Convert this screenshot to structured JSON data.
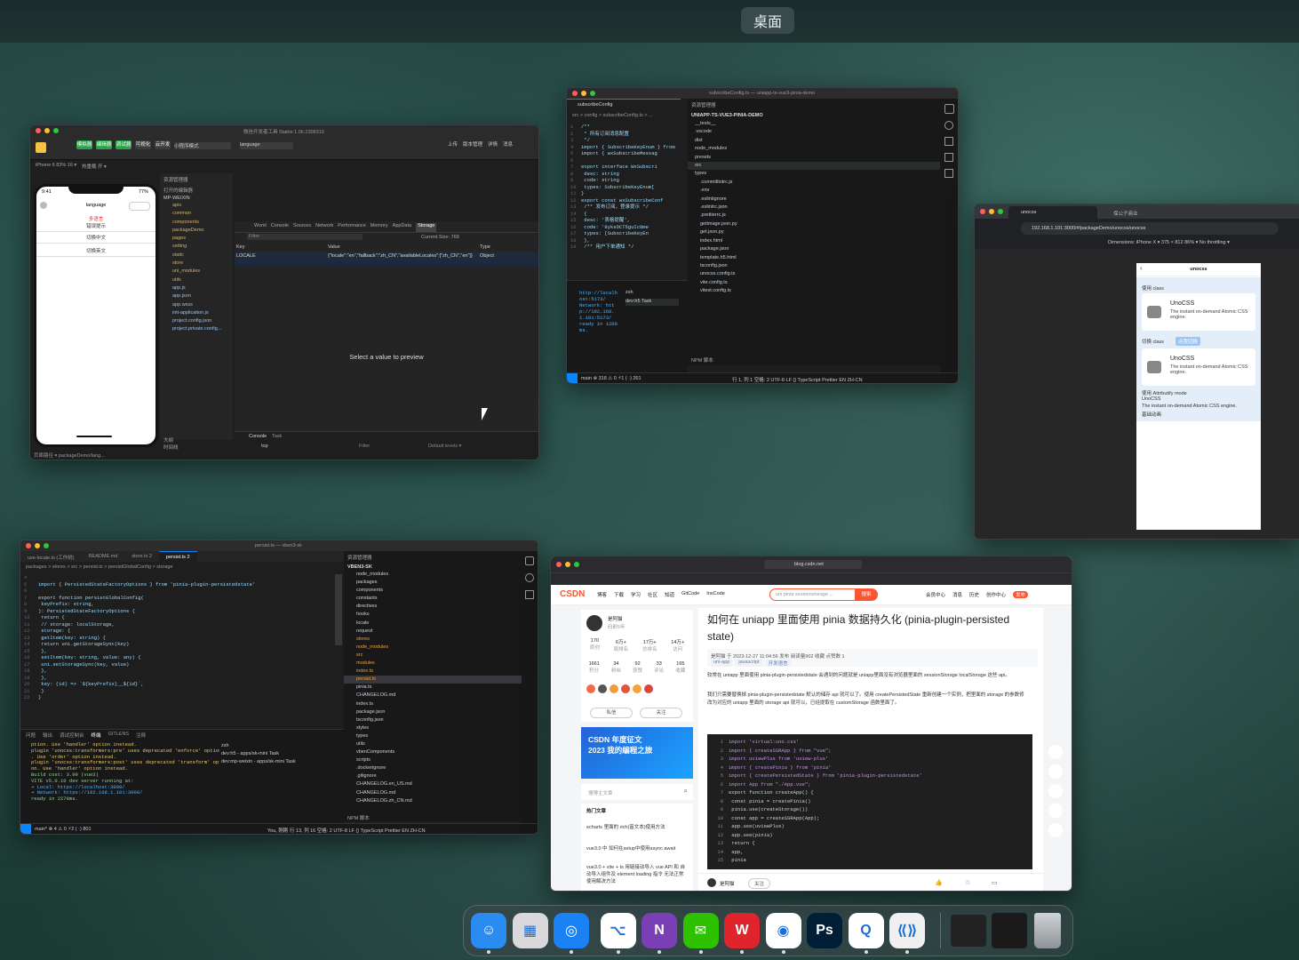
{
  "desktop": {
    "label": "桌面"
  },
  "devtools": {
    "title": "微信开发者工具 Stable 1.06.2308310",
    "toolbar": [
      "模拟器",
      "编辑器",
      "调试器",
      "可视化",
      "云开发",
      "上传",
      "版本管理",
      "详情",
      "消息"
    ],
    "compile_mode": "小程序模式",
    "device": "iPhone 6 83% 16 ▾",
    "hot_reload": "热重载 开 ▾",
    "phone": {
      "status_time": "9:41",
      "battery": "77%",
      "title": "language",
      "lines": [
        "多语言",
        "错误提示",
        "切换中文",
        "切换英文"
      ]
    },
    "explorer_title": "资源管理器",
    "open_editors": "打开的编辑器",
    "project_root": "MP-WEIXIN",
    "files": [
      "apis",
      "common",
      "components",
      "packageDemo",
      "pages",
      "setting",
      "static",
      "store",
      "uni_modules",
      "utils",
      "app.js",
      "app.json",
      "app.wxss",
      "init-application.js",
      "project.config.json",
      "project.private.config..."
    ],
    "debug_tabs": [
      "Wxml",
      "Console",
      "Sources",
      "Network",
      "Performance",
      "Memory",
      "AppData",
      "Storage"
    ],
    "filter_placeholder": "Filter",
    "storage_size": "Current Size: 768",
    "storage_headers": [
      "Key",
      "Value",
      "Type"
    ],
    "storage_row": {
      "key": "LOCALE",
      "value": "{\"locale\":\"en\",\"fallback\":\"zh_CN\",\"availableLocales\":[\"zh_CN\",\"en\"]}",
      "type": "Object"
    },
    "preview_placeholder": "Select a value to preview",
    "console_tabs": [
      "Console",
      "Task"
    ],
    "console_context": "top",
    "console_filter": "Filter",
    "console_levels": "Default levels ▾",
    "outline": [
      "大纲",
      "时间线"
    ],
    "statusbar": "页面路径 ▾  packageDemo/lang..."
  },
  "vscode1": {
    "title": "subscribeConfig.ts — uniapp-ts-vue3-pinia-demo",
    "tab": "subscribeConfig",
    "breadcrumb": "src > config > subscribeConfig.ts > ...",
    "code": [
      "/**",
      " * 所有订阅消息配置",
      " */",
      "import { SubscribeKeyEnum } from",
      "import { wxSubscribeMessag",
      "",
      "export interface WxSubscri",
      "  desc: string",
      "  code: string",
      "  types: SubscribeKeyEnum[",
      "}",
      "export const wxSubscribeConf",
      "  /** 发布订阅，登录提示 */",
      "  {",
      "    desc: '表格提醒',",
      "    code: '8yksDCT5guIc8me",
      "    types: [SubscribeKeyEn",
      "  },",
      "  /** 用户下单通知 */"
    ],
    "explorer_title": "资源管理器",
    "project": "UNIAPP-TS-VUE3-PINIA-DEMO",
    "files": [
      "__tests__",
      ".vscode",
      "dist",
      "node_modules",
      "presets",
      "src",
      "types",
      ".commitlintrc.js",
      ".env",
      ".eslintignore",
      ".eslintrc.json",
      ".prettierrc.js",
      "getimage.json.py",
      "get.json.py",
      "index.html",
      "package.json",
      "template.h5.html",
      "tsconfig.json",
      "unocss.config.ts",
      "vite.config.ts",
      "vitest.config.ts"
    ],
    "terminal": [
      "http://localhost:5173/",
      "Network: http://192.168.1.101:5173/",
      "ready in 1209ms."
    ],
    "terminal_tabs": [
      "zsh",
      "dev:h5 Task"
    ],
    "npm": "NPM 脚本",
    "status_left": "main  ⊗ 318 ⚠ 0  ⚡1  ( ·) 261",
    "status_right": "行 1, 列 1  空格: 2  UTF-8  LF  {} TypeScript  Prettier  EN  ZH-CN"
  },
  "browser": {
    "tabs": [
      "unocss",
      "保公子商业"
    ],
    "url": "192.168.1.101:3000/#/packageDemo/unocss/unocss",
    "device_bar": "Dimensions: iPhone X ▾   375  ×  812   86% ▾  No throttling ▾",
    "page_title": "unocss",
    "section1": "使用 class",
    "card_title": "UnoCSS",
    "card_desc": "The instant on-demand Atomic CSS engine.",
    "section2": "切换 class",
    "badge": "点我切换",
    "section3": "使用 Attributify mode",
    "attr_title": "UnoCSS",
    "attr_desc": "The instant on-demand Atomic CSS engine.",
    "attr_extra": "基础动画"
  },
  "vscode2": {
    "title": "persist.ts — vben3-sk",
    "tabs": [
      "use-locale.ts (工作树)",
      "README.md",
      "store.ts 2",
      "persist.ts 2"
    ],
    "breadcrumb": "packages > stores > src > persist.ts > persistGlobalConfig > storage",
    "code": [
      "",
      "import { PersistedStateFactoryOptions } from 'pinia-plugin-persistedstate'",
      "",
      "export function persistGlobalConfig(",
      "  keyPrefix: string,",
      "): PersistedStateFactoryOptions {",
      "  return {",
      "    // storage: localStorage,",
      "    storage: {",
      "      getItem(key: string) {",
      "        return uni.getStorageSync(key)",
      "      },",
      "      setItem(key: string, value: any) {",
      "        uni.setStorageSync(key, value)",
      "      },",
      "    },",
      "    key: (id) => `${keyPrefix}__${id}`,",
      "  }",
      "}"
    ],
    "explorer": "资源管理器",
    "project": "VBEN3-SK",
    "files": [
      "node_modules",
      "packages",
      "components",
      "constants",
      "directives",
      "hooks",
      "locale",
      "request",
      "stores",
      "node_modules",
      "src",
      "modules",
      "index.ts",
      "persist.ts",
      "pinia.ts",
      "CHANGELOG.md",
      "index.ts",
      "package.json",
      "tsconfig.json",
      "styles",
      "types",
      "utils",
      "vbenComponents",
      "scripts",
      ".dockerignore",
      ".gitignore",
      "CHANGELOG.en_US.md",
      "CHANGELOG.md",
      "CHANGELOG.zh_CN.md"
    ],
    "panel_tabs": [
      "问题",
      "输出",
      "调试控制台",
      "终端",
      "GITLENS",
      "注释"
    ],
    "terminal": [
      "ption. Use 'handler' option instead.",
      " plugin 'unocss:transformers:pre' uses deprecated 'enforce' option",
      ". Use 'order' option instead.",
      " plugin 'unocss:transformers:post' uses deprecated 'transform' opti",
      "on. Use 'handler' option instead.",
      "Build cost: 3.99 (vue3)",
      "",
      "  VITE v5.0.10  dev server running at:",
      "",
      "  ➜  Local:   https://localhost:3000/",
      "  ➜  Network: https://192.168.1.101:3000/",
      "",
      "  ready in 2278ms."
    ],
    "terminal_list": [
      "zsh",
      "dev:h5 - apps/sk-mini Task",
      "dev:mp-weixin - apps/sk-mini Task"
    ],
    "npm": "NPM 脚本",
    "status_left": "main*  ⊗ 4 ⚠ 0  ⚡2  ( ·) 801",
    "status_right": "You, 刚刚  行 13, 列 16  空格: 2  UTF-8  LF  {} TypeScript  Prettier  EN  ZH-CN"
  },
  "csdn": {
    "url": "blog.csdn.net",
    "nav": [
      "博客",
      "下载",
      "学习",
      "社区",
      "知道",
      "GitCode",
      "InsCode"
    ],
    "search": "uni pinia sessionstorage ...",
    "search_btn": "搜索",
    "nav_right": [
      "会员中心",
      "消息",
      "历史",
      "创作中心",
      "发布"
    ],
    "author": "是阿猫",
    "author_meta": "码龄5年",
    "stats_row1": [
      [
        "170",
        "原创"
      ],
      [
        "6万+",
        "周排名"
      ],
      [
        "17万+",
        "总排名"
      ],
      [
        "14万+",
        "访问"
      ]
    ],
    "stats_row2": [
      [
        "1661",
        "积分"
      ],
      [
        "34",
        "粉丝"
      ],
      [
        "92",
        "获赞"
      ],
      [
        "33",
        "评论"
      ],
      [
        "165",
        "收藏"
      ]
    ],
    "btn_msg": "私信",
    "btn_follow": "关注",
    "promo": [
      "CSDN 年度征文",
      "2023 我的编程之旅"
    ],
    "search_blog": "搜博主文章",
    "hot": "热门文章",
    "hot_items": [
      "echarts 里面的 rich(富文本)使用方法",
      "vue3.0 中 如何在setup中使用async await",
      "vue3.0 + vite + ts 用链接动导入 vue API 和 自动导入组件及 element loading 指令 无法正常使用解决方法"
    ],
    "article_title": "如何在 uniapp 里面使用 pinia 数据持久化 (pinia-plugin-persisted state)",
    "article_meta": "是阿猫  于 2023-12-27 11:04:56 发布  阅读量902  收藏  点赞数 1",
    "tags": [
      "uni-app",
      "javascript",
      "开发语言"
    ],
    "para1": "较常在 uniapp 里面使用 pinia-plugin-persistedstate 会遇到的问题就是 uniapp里面没有浏览器里面的 sessionStorage localStorage 这些 api。",
    "para2": "我们只需要替换掉 pinia-plugin-persistedstate 默认的储存 api 就可以了。使用 createPersistedState 重新创建一个实例，把里面的 storage 的参数修改为对应的 uniapp 里面的 storage api 就可以，已经提取在 customStorage 函数里面了。",
    "code": [
      "import 'virtual:uno.css'",
      "import { createSSRApp } from \"vue\";",
      "import uviewPlus from 'uview-plus'",
      "import { createPinia } from 'pinia'",
      "import { createPersistedState } from 'pinia-plugin-persistedstate'",
      "import App from \"./App.vue\";",
      "export function createApp() {",
      "  const pinia = createPinia()",
      "  pinia.use(createStorage())",
      "  const app = createSSRApp(App);",
      "  app.use(uviewPlus)",
      "  app.use(pinia)",
      "  return {",
      "    app,",
      "    pinia"
    ],
    "footer_author": "是阿猫",
    "footer_follow": "关注"
  },
  "dock": {
    "apps": [
      {
        "name": "finder",
        "glyph": "☺",
        "color": "#2a8cf0"
      },
      {
        "name": "launchpad",
        "glyph": "▦",
        "color": "#d9d9dc"
      },
      {
        "name": "safari",
        "glyph": "◎",
        "color": "#1a82f5"
      },
      {
        "name": "vscode",
        "glyph": "⌥",
        "color": "#ffffff"
      },
      {
        "name": "onenote",
        "glyph": "N",
        "color": "#7b3fb5"
      },
      {
        "name": "wechat",
        "glyph": "✉",
        "color": "#2dc100"
      },
      {
        "name": "wps",
        "glyph": "W",
        "color": "#e0242c"
      },
      {
        "name": "chrome",
        "glyph": "◉",
        "color": "#ffffff"
      },
      {
        "name": "photoshop",
        "glyph": "Ps",
        "color": "#001e36"
      },
      {
        "name": "qq-browser",
        "glyph": "Q",
        "color": "#ffffff"
      },
      {
        "name": "wechat-devtools",
        "glyph": "⟪⟫",
        "color": "#f0f0f0"
      }
    ]
  }
}
